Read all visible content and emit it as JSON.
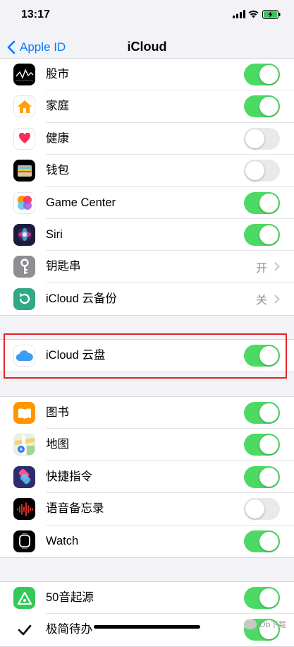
{
  "status_bar": {
    "time": "13:17"
  },
  "nav": {
    "back_label": "Apple ID",
    "title": "iCloud"
  },
  "group1": [
    {
      "label": "股市",
      "icon": "stocks-icon",
      "state": "on"
    },
    {
      "label": "家庭",
      "icon": "home-icon",
      "state": "on"
    },
    {
      "label": "健康",
      "icon": "health-icon",
      "state": "off"
    },
    {
      "label": "钱包",
      "icon": "wallet-icon",
      "state": "off"
    },
    {
      "label": "Game Center",
      "icon": "game-center-icon",
      "state": "on"
    },
    {
      "label": "Siri",
      "icon": "siri-icon",
      "state": "on"
    },
    {
      "label": "钥匙串",
      "icon": "keychain-icon",
      "detail": "开"
    },
    {
      "label": "iCloud 云备份",
      "icon": "icloud-backup-icon",
      "detail": "关"
    }
  ],
  "group2": [
    {
      "label": "iCloud 云盘",
      "icon": "icloud-drive-icon",
      "state": "on"
    }
  ],
  "group3": [
    {
      "label": "图书",
      "icon": "books-icon",
      "state": "on"
    },
    {
      "label": "地图",
      "icon": "maps-icon",
      "state": "on"
    },
    {
      "label": "快捷指令",
      "icon": "shortcuts-icon",
      "state": "on"
    },
    {
      "label": "语音备忘录",
      "icon": "voice-memos-icon",
      "state": "off"
    },
    {
      "label": "Watch",
      "icon": "watch-icon",
      "state": "on"
    }
  ],
  "group4": [
    {
      "label": "50音起源",
      "icon": "50on-app-icon",
      "state": "on"
    },
    {
      "label": "极简待办",
      "icon": "todo-app-icon",
      "state": "on"
    }
  ],
  "watermark": "Ob下载",
  "colors": {
    "accent": "#007aff",
    "toggle_on": "#4cd964",
    "highlight": "#e0252b"
  }
}
